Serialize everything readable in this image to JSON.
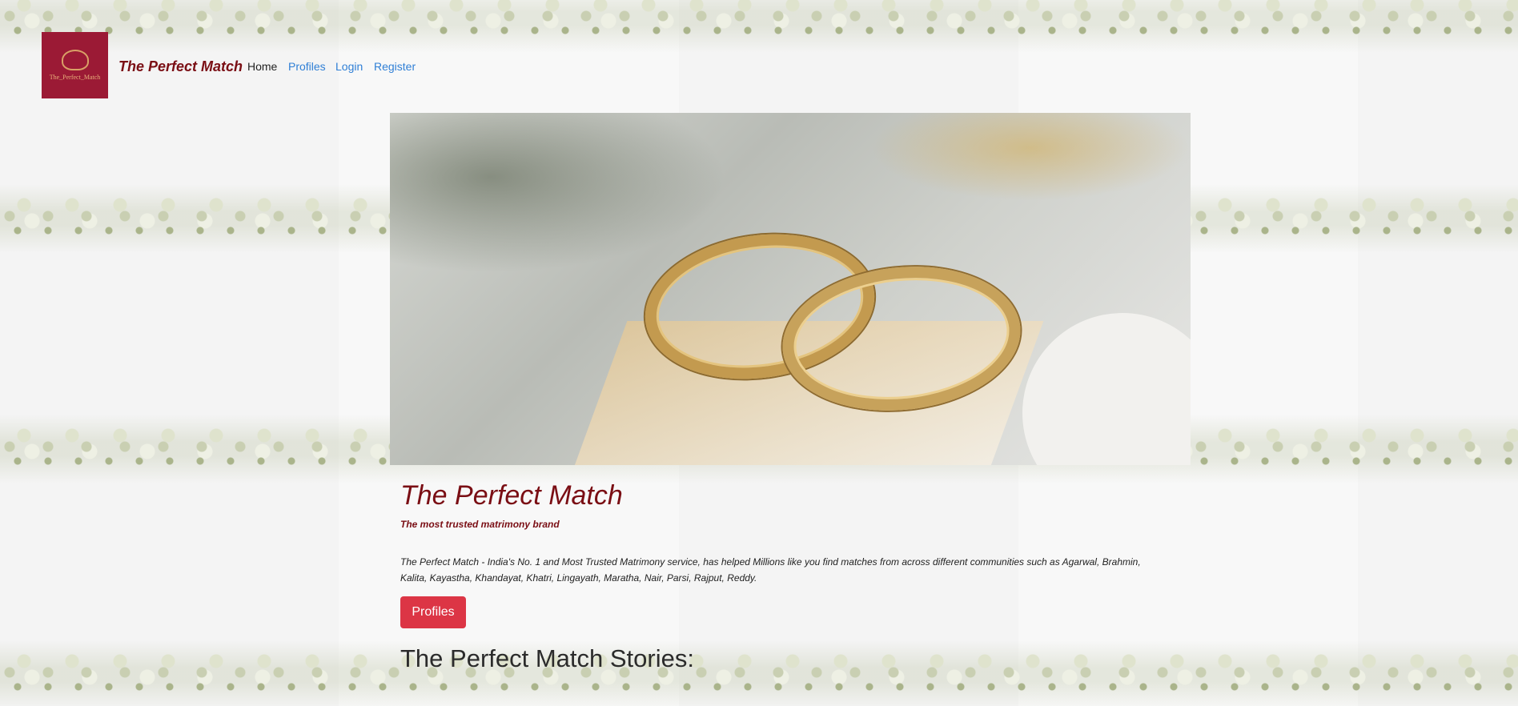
{
  "navbar": {
    "logo_text": "The_Perfect_Match",
    "brand": "The Perfect Match",
    "links": [
      "Home",
      "Profiles",
      "Login",
      "Register"
    ]
  },
  "hero": {
    "image": "wedding-rings-image"
  },
  "main": {
    "title": "The Perfect Match",
    "subtitle": "The most trusted matrimony brand",
    "description": "The Perfect Match - India's No. 1 and Most Trusted Matrimony service, has helped Millions like you find matches from across different communities such as Agarwal, Brahmin, Kalita, Kayastha, Khandayat, Khatri, Lingayath, Maratha, Nair, Parsi, Rajput, Reddy.",
    "profiles_button": "Profiles",
    "stories_heading": "The Perfect Match Stories:"
  },
  "colors": {
    "brand": "#7a0e14",
    "logo_bg": "#9b1a35",
    "link": "#2f7fd6",
    "button": "#dc3545"
  }
}
